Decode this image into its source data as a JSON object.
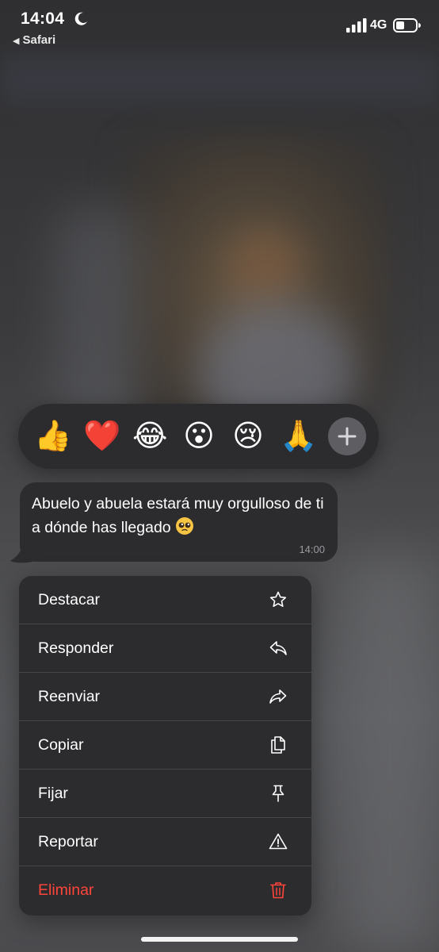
{
  "status_bar": {
    "time": "14:04",
    "back_app": "Safari",
    "network": "4G",
    "icons": [
      "moon-icon",
      "signal-icon",
      "battery-icon"
    ]
  },
  "reactions": {
    "emojis": [
      "👍",
      "❤️",
      "😂",
      "😮",
      "😢",
      "🙏"
    ],
    "more_icon": "plus-icon"
  },
  "message": {
    "text": "Abuelo y abuela estará muy orgulloso de ti a dónde has llegado",
    "emoji": "pleading-face",
    "time": "14:00"
  },
  "menu": {
    "items": [
      {
        "label": "Destacar",
        "icon": "star-icon"
      },
      {
        "label": "Responder",
        "icon": "reply-icon"
      },
      {
        "label": "Reenviar",
        "icon": "forward-icon"
      },
      {
        "label": "Copiar",
        "icon": "copy-icon"
      },
      {
        "label": "Fijar",
        "icon": "pin-icon"
      },
      {
        "label": "Reportar",
        "icon": "warning-icon"
      },
      {
        "label": "Eliminar",
        "icon": "trash-icon"
      }
    ]
  },
  "colors": {
    "panel": "#2c2c2e",
    "danger": "#ff453a",
    "timestamp": "#9a9aa0"
  }
}
